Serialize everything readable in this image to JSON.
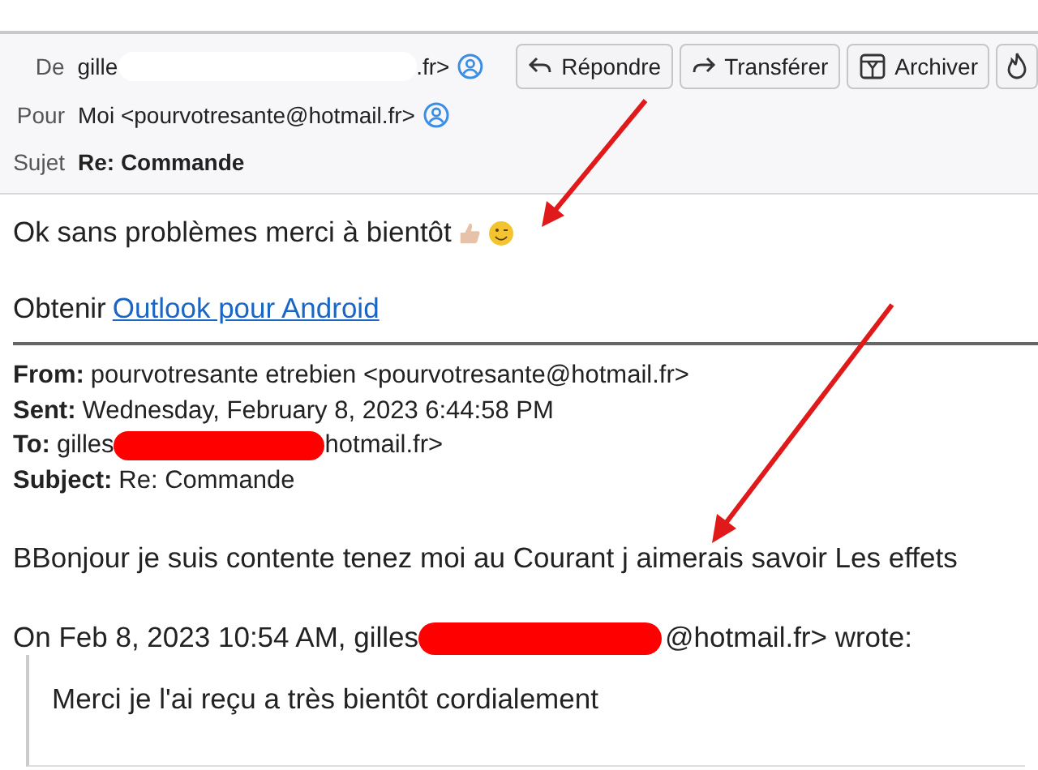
{
  "header": {
    "fields": [
      {
        "label": "De",
        "kind": "address",
        "value_before": "gille",
        "value_after": ".fr>",
        "redacted": true
      },
      {
        "label": "Pour",
        "kind": "address",
        "value_before": "Moi <pourvotresante@hotmail.fr>"
      },
      {
        "label": "Sujet",
        "kind": "subject",
        "value_before": "Re: Commande"
      }
    ],
    "buttons": [
      {
        "kind": "reply",
        "label": "Répondre"
      },
      {
        "kind": "forward",
        "label": "Transférer"
      },
      {
        "kind": "archive",
        "label": "Archiver"
      },
      {
        "kind": "junk"
      }
    ]
  },
  "body": {
    "message": "Ok sans problèmes merci à bientôt",
    "promo": {
      "prefix": "Obtenir",
      "link": "Outlook pour Android"
    },
    "quoted_header": [
      {
        "label": "From:",
        "value_before": "pourvotresante etrebien <pourvotresante@hotmail.fr>"
      },
      {
        "label": "Sent:",
        "value_before": "Wednesday, February 8, 2023 6:44:58 PM"
      },
      {
        "label": "To:",
        "value_before": "gilles",
        "value_after": "hotmail.fr>",
        "redacted": true
      },
      {
        "label": "Subject:",
        "value_before": "Re: Commande"
      }
    ],
    "reply": "BBonjour je suis contente tenez moi au Courant j aimerais savoir Les effets",
    "attribution": {
      "value_before": "On Feb 8, 2023 10:54 AM, gilles",
      "value_after": "@hotmail.fr> wrote:",
      "redacted": true
    },
    "quote": "Merci je l'ai reçu a très bientôt cordialement"
  }
}
